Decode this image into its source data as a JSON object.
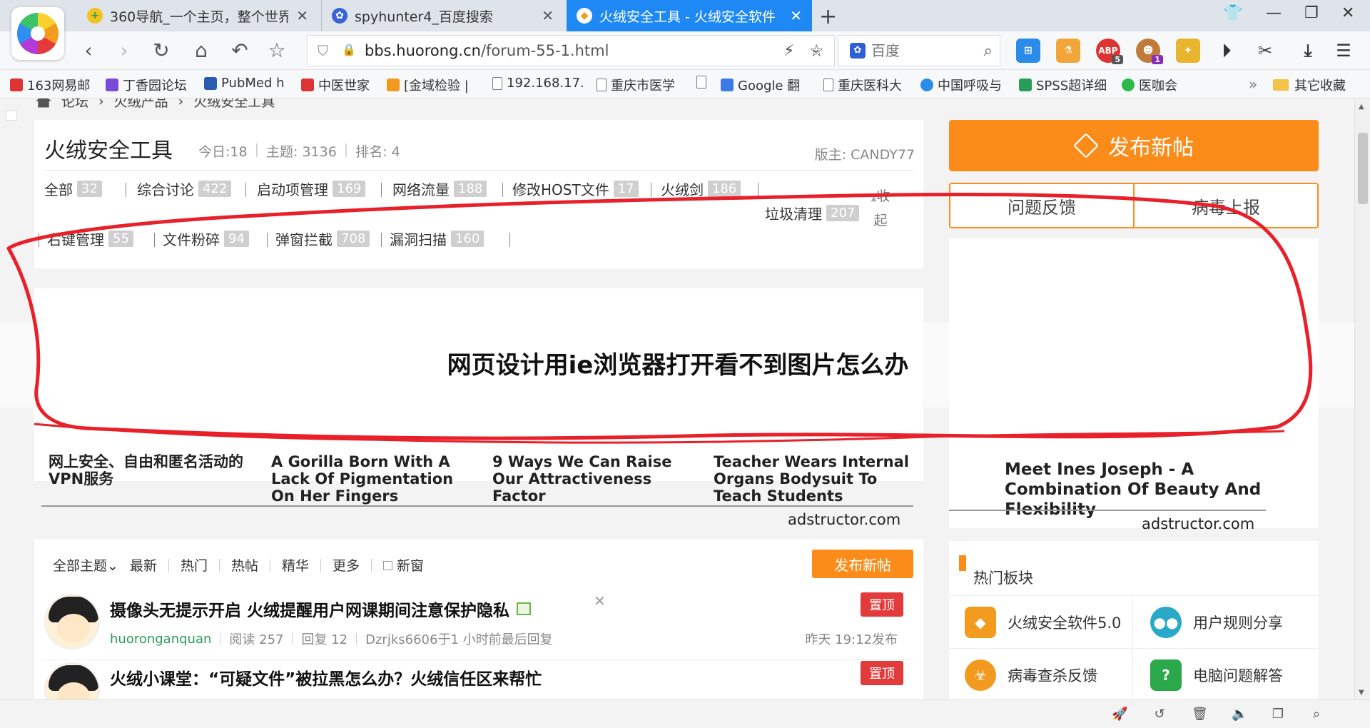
{
  "browser": {
    "tabs": [
      {
        "title": "360导航_一个主页，整个世界",
        "icon_color": "#f4c21f",
        "icon_glyph": "+"
      },
      {
        "title": "spyhunter4_百度搜索",
        "icon_color": "#3a63d8",
        "icon_glyph": "✿"
      },
      {
        "title": "火绒安全工具 - 火绒安全软件 -",
        "icon_color": "#f39b1f",
        "icon_glyph": "◆"
      }
    ],
    "new_tab_glyph": "+",
    "address": {
      "host": "bbs.huorong.cn",
      "path": "/forum-55-1.html"
    },
    "search": {
      "placeholder": "百度"
    },
    "extensions": [
      {
        "name": "windows-icon",
        "color": "#2b8be8",
        "glyph": "⊞"
      },
      {
        "name": "microscope-icon",
        "color": "#f2a63a",
        "glyph": "⚗"
      },
      {
        "name": "adblock-icon",
        "color": "#d33",
        "glyph": "ABP",
        "badge": "5"
      },
      {
        "name": "monkey-icon",
        "color": "#c07a3a",
        "glyph": "☻",
        "badge": "1"
      },
      {
        "name": "tiger-icon",
        "color": "#e8b52e",
        "glyph": "✦"
      }
    ],
    "bookmarks": [
      {
        "label": "163网易邮",
        "color": "#d33"
      },
      {
        "label": "丁香园论坛",
        "color": "#7a4ad8"
      },
      {
        "label": "PubMed h",
        "color": "#2a5db0"
      },
      {
        "label": "中医世家",
        "color": "#d33"
      },
      {
        "label": "[金域检验 |",
        "color": "#f29a1f"
      },
      {
        "label": "192.168.17.",
        "color": "page"
      },
      {
        "label": "重庆市医学",
        "color": "page"
      },
      {
        "label": "",
        "color": "page"
      },
      {
        "label": "Google 翻",
        "color": "#3a7be8"
      },
      {
        "label": "重庆医科大",
        "color": "page"
      },
      {
        "label": "中国呼吸与",
        "color": "#2a8ee8"
      },
      {
        "label": "SPSS超详细",
        "color": "#2a9d5a"
      },
      {
        "label": "医咖会",
        "color": "#2db84a"
      }
    ],
    "bookmarks_more": "»",
    "bookmarks_other": "其它收藏"
  },
  "breadcrumb": [
    "论坛",
    "火绒产品",
    "火绒安全工具"
  ],
  "forum": {
    "title": "火绒安全工具",
    "today": "今日:18",
    "topics": "主题: 3136",
    "rank": "排名: 4",
    "moderator": "版主: CANDY77",
    "collapse_label": "收起",
    "categories": [
      {
        "label": "全部",
        "count": "32"
      },
      {
        "label": "综合讨论",
        "count": "422"
      },
      {
        "label": "启动项管理",
        "count": "169"
      },
      {
        "label": "网络流量",
        "count": "188"
      },
      {
        "label": "修改HOST文件",
        "count": "17"
      },
      {
        "label": "火绒剑",
        "count": "186"
      },
      {
        "label": "垃圾清理",
        "count": "207"
      },
      {
        "label": "右键管理",
        "count": "55"
      },
      {
        "label": "文件粉碎",
        "count": "94"
      },
      {
        "label": "弹窗拦截",
        "count": "708"
      },
      {
        "label": "漏洞扫描",
        "count": "160"
      }
    ]
  },
  "ad": {
    "headline": "网页设计用ie浏览器打开看不到图片怎么办",
    "items": [
      "网上安全、自由和匿名活动的VPN服务",
      "A Gorilla Born With A Lack Of Pigmentation On Her Fingers",
      "9 Ways We Can Raise Our Attractiveness Factor",
      "Teacher Wears Internal Organs Bodysuit To Teach Students"
    ],
    "side_item": "Meet Ines Joseph - A Combination Of Beauty And Flexibility",
    "source": "adstructor.com",
    "scribble_color": "#e8202a"
  },
  "sidebar": {
    "publish_label": "发布新帖",
    "feedback_label": "问题反馈",
    "virus_label": "病毒上报",
    "hot_title": "热门板块",
    "hot_items": [
      {
        "label": "火绒安全软件5.0",
        "color": "#f39b1f",
        "glyph": "◆"
      },
      {
        "label": "用户规则分享",
        "color": "#2aa8c8",
        "glyph": "●●"
      },
      {
        "label": "病毒查杀反馈",
        "color": "#f29a1f",
        "glyph": "☣"
      },
      {
        "label": "电脑问题解答",
        "color": "#2aa84a",
        "glyph": "?"
      }
    ]
  },
  "threads": {
    "filters": [
      "全部主题",
      "最新",
      "热门",
      "热帖",
      "精华",
      "更多",
      "新窗"
    ],
    "publish_label": "发布新帖",
    "items": [
      {
        "title": "摄像头无提示开启 火绒提醒用户网课期间注意保护隐私",
        "top_label": "置顶",
        "author": "huoronganquan",
        "reads": "阅读 257",
        "replies": "回复 12",
        "last_reply": "Dzrjks6606于1 小时前最后回复",
        "date": "昨天 19:12发布"
      },
      {
        "title": "火绒小课堂：“可疑文件”被拉黑怎么办？火绒信任区来帮忙",
        "top_label": "置顶"
      }
    ]
  }
}
